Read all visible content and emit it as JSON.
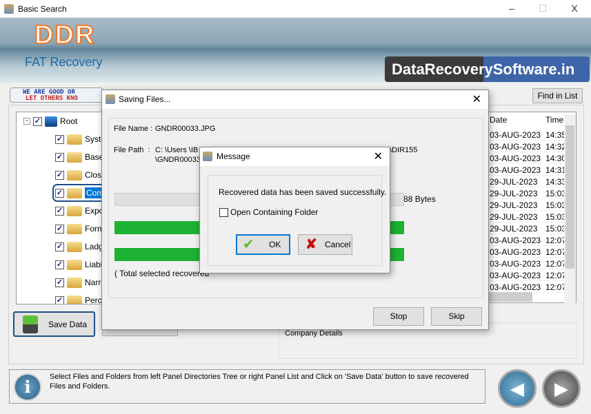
{
  "window": {
    "title": "Basic Search",
    "minimize": "–",
    "maximize": "☐",
    "close": "X"
  },
  "banner": {
    "logo_text": "DDR",
    "product": "FAT Recovery",
    "site": "DataRecoverySoftware.in"
  },
  "good_banner": {
    "line1": "WE ARE GOOD OR",
    "line2": "LET OTHERS KNO"
  },
  "find_in_list": "Find in List",
  "tree": {
    "root": "Root",
    "items": [
      "Syste",
      "Base",
      "Closi",
      "Comp",
      "Expo",
      "Form",
      "Ladg",
      "Liabil",
      "Narra",
      "Perce"
    ],
    "selected_index": 3
  },
  "list": {
    "headers": {
      "date": "Date",
      "time": "Time"
    },
    "rows": [
      {
        "date": "03-AUG-2023",
        "time": "14:35"
      },
      {
        "date": "03-AUG-2023",
        "time": "14:32"
      },
      {
        "date": "03-AUG-2023",
        "time": "14:30"
      },
      {
        "date": "03-AUG-2023",
        "time": "14:31"
      },
      {
        "date": "29-JUL-2023",
        "time": "14:33"
      },
      {
        "date": "29-JUL-2023",
        "time": "15:03"
      },
      {
        "date": "29-JUL-2023",
        "time": "15:03"
      },
      {
        "date": "29-JUL-2023",
        "time": "15:03"
      },
      {
        "date": "29-JUL-2023",
        "time": "15:03"
      },
      {
        "date": "03-AUG-2023",
        "time": "12:07"
      },
      {
        "date": "03-AUG-2023",
        "time": "12:07"
      },
      {
        "date": "03-AUG-2023",
        "time": "12:07"
      },
      {
        "date": "03-AUG-2023",
        "time": "12:07"
      },
      {
        "date": "03-AUG-2023",
        "time": "12:07"
      }
    ]
  },
  "save_data": "Save Data",
  "company_details": "Company Details",
  "status_text": "Select Files and Folders from left Panel Directories Tree or right Panel List and Click on 'Save Data' button to save recovered Files and Folders.",
  "saving": {
    "title": "Saving Files...",
    "file_name_label": "File Name :",
    "file_name": "GNDR00033.JPG",
    "file_path_label": "File Path  :",
    "file_path_1": "C: \\Users \\IB",
    "file_path_1_end": "\\DIR155",
    "file_path_2": "\\GNDR00033",
    "bytes": "29088 Bytes",
    "total": "( Total selected recovered",
    "stop": "Stop",
    "skip": "Skip"
  },
  "message": {
    "title": "Message",
    "text": "Recovered data has been saved successfully.",
    "checkbox": "Open Containing Folder",
    "checked": false,
    "ok": "OK",
    "cancel": "Cancel"
  },
  "colors": {
    "progress": "#1db233",
    "accent": "#0078d7"
  }
}
